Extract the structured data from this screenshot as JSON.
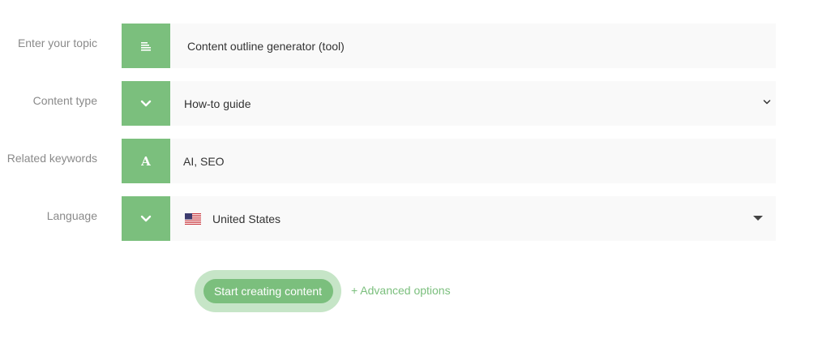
{
  "form": {
    "topic": {
      "label": "Enter your topic",
      "value": "Content outline generator (tool)",
      "icon": "text-lines-icon"
    },
    "content_type": {
      "label": "Content type",
      "value": "How-to guide",
      "icon": "chevron-down-icon"
    },
    "keywords": {
      "label": "Related keywords",
      "value": "AI, SEO",
      "icon": "letter-a-icon",
      "icon_glyph": "A"
    },
    "language": {
      "label": "Language",
      "value": "United States",
      "icon": "chevron-down-icon",
      "flag": "us-flag-icon"
    }
  },
  "actions": {
    "start_label": "Start creating content",
    "advanced_label": "+ Advanced options"
  },
  "colors": {
    "accent": "#7bbf7d",
    "accent_light": "#c6e5c7",
    "field_bg": "#f9f9f9",
    "label_text": "#8a8a8a",
    "value_text": "#333333"
  }
}
